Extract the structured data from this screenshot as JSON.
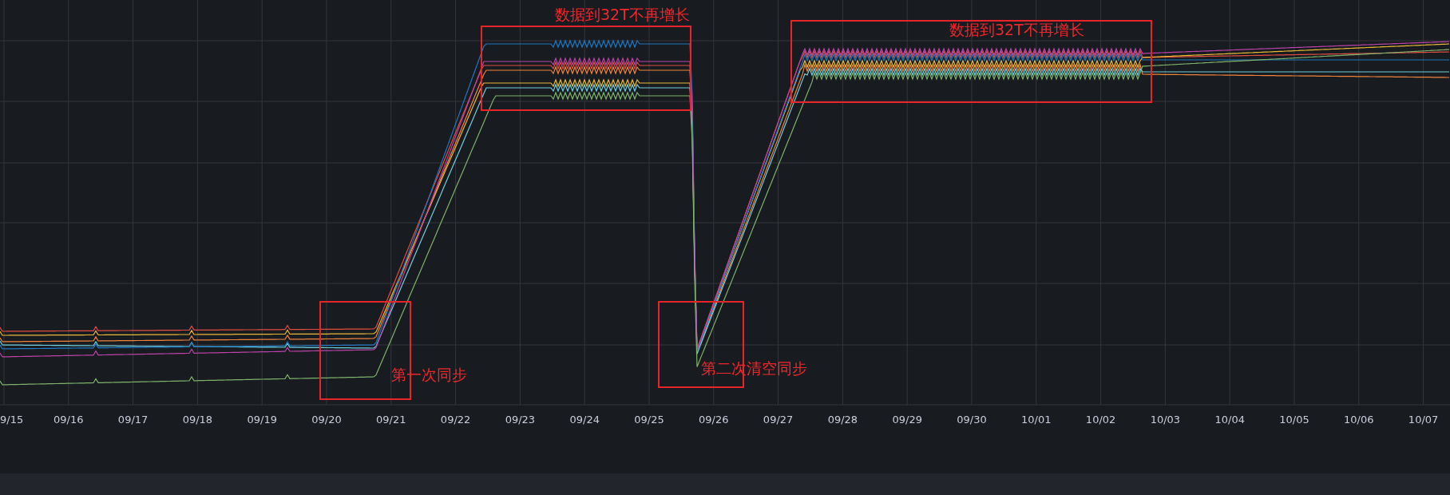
{
  "chart": {
    "x_labels": [
      "9/15",
      "09/16",
      "09/17",
      "09/18",
      "09/19",
      "09/20",
      "09/21",
      "09/22",
      "09/23",
      "09/24",
      "09/25",
      "09/26",
      "09/27",
      "09/28",
      "09/29",
      "09/30",
      "10/01",
      "10/02",
      "10/03",
      "10/04",
      "10/05",
      "10/06",
      "10/07"
    ]
  },
  "annotations": [
    {
      "text": "数据到32T不再增长"
    },
    {
      "text": "数据到32T不再增长"
    },
    {
      "text": "第一次同步"
    },
    {
      "text": "第二次清空同步"
    }
  ]
}
